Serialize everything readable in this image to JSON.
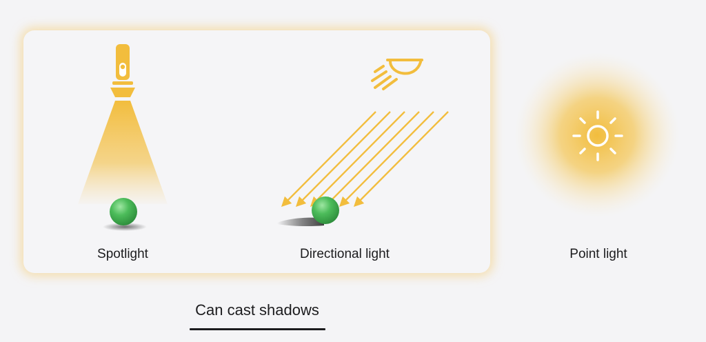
{
  "lights": {
    "spotlight": {
      "label": "Spotlight",
      "casts_shadow": true
    },
    "directional": {
      "label": "Directional light",
      "casts_shadow": true
    },
    "point": {
      "label": "Point light",
      "casts_shadow": false
    }
  },
  "caption": "Can cast shadows",
  "colors": {
    "accent": "#f2bd3d",
    "glow": "#f6cd78",
    "sphere": "#4cbc5a",
    "panel": "#f5f5f7",
    "background": "#f4f4f6",
    "text": "#1c1c1e"
  },
  "icons": {
    "spotlight": "flashlight-icon",
    "directional": "wall-light-icon",
    "point": "sun-icon"
  }
}
